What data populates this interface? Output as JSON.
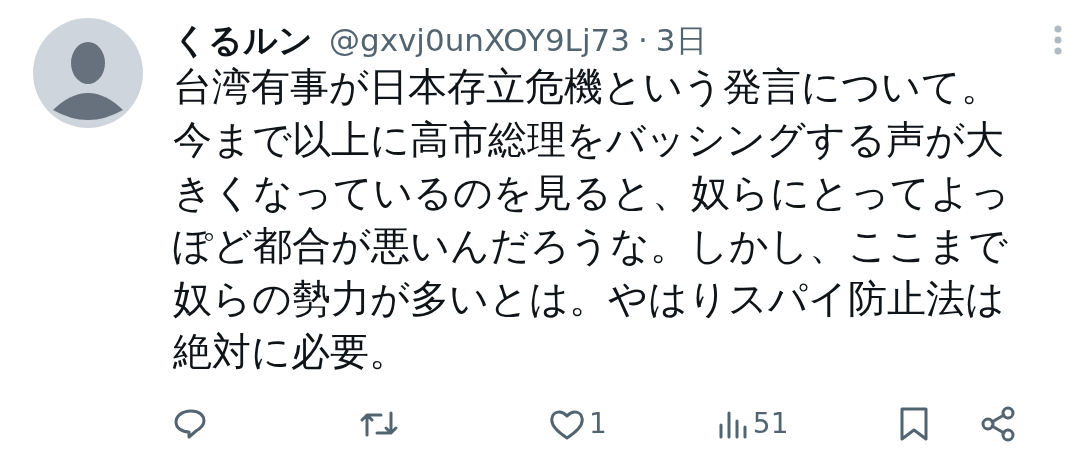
{
  "tweet": {
    "display_name": "くるルン",
    "handle": "@gxvj0unXOY9Lj73",
    "separator": "·",
    "time": "3日",
    "text": "台湾有事が日本存立危機という発言について。今まで以上に高市総理をバッシングする声が大きくなっているのを見ると、奴らにとってよっぽど都合が悪いんだろうな。しかし、ここまで奴らの勢力が多いとは。やはりスパイ防止法は絶対に必要。"
  },
  "actions": [
    {
      "kind": "reply"
    },
    {
      "kind": "retweet"
    },
    {
      "kind": "like",
      "count": "1"
    },
    {
      "kind": "views",
      "count": "51"
    },
    {
      "kind": "bookmark"
    },
    {
      "kind": "share"
    }
  ]
}
